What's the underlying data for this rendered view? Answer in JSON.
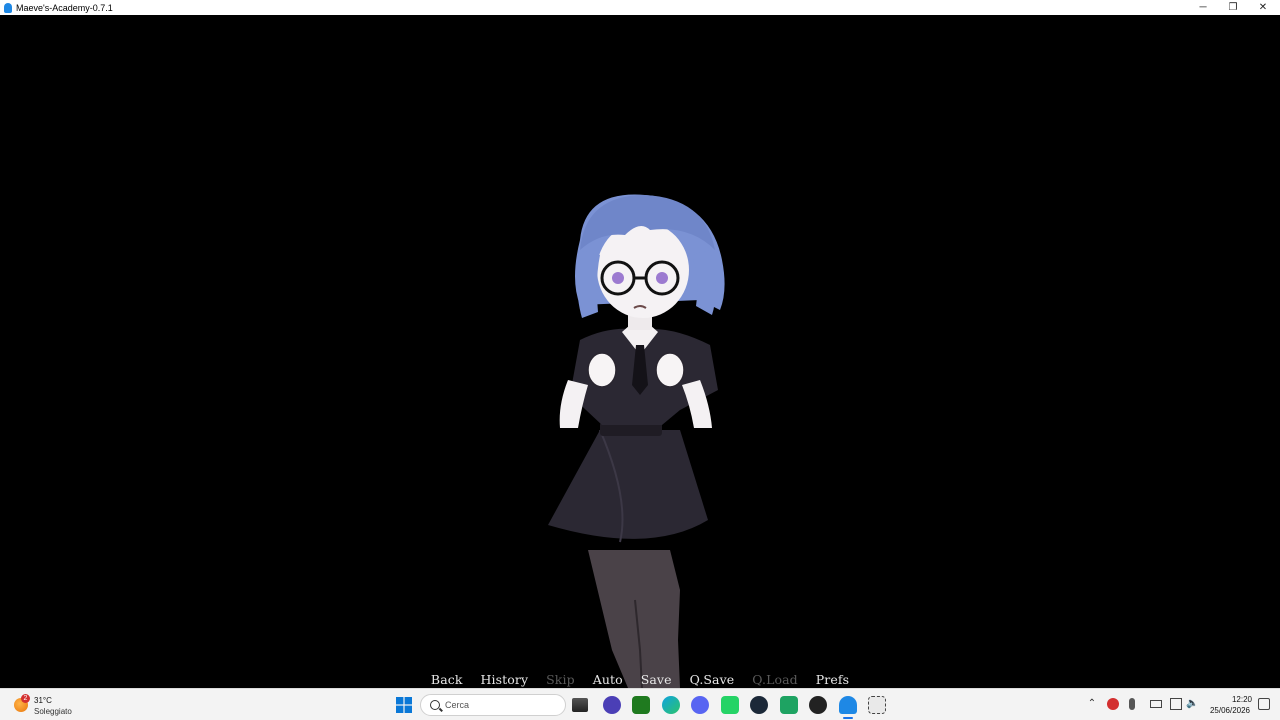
{
  "window": {
    "title": "Maeve's-Academy-0.7.1",
    "controls": [
      "─",
      "❐",
      "✕"
    ]
  },
  "quick_menu": [
    {
      "label": "Back",
      "enabled": true
    },
    {
      "label": "History",
      "enabled": true
    },
    {
      "label": "Skip",
      "enabled": false
    },
    {
      "label": "Auto",
      "enabled": true
    },
    {
      "label": "Save",
      "enabled": true
    },
    {
      "label": "Q.Save",
      "enabled": true
    },
    {
      "label": "Q.Load",
      "enabled": false
    },
    {
      "label": "Prefs",
      "enabled": true
    }
  ],
  "taskbar": {
    "weather": {
      "temp": "31°C",
      "desc": "Soleggiato",
      "badge": "2"
    },
    "search_placeholder": "Cerca",
    "pinned": [
      "file-explorer-icon",
      "protonvpn-icon",
      "xbox-icon",
      "edge-icon",
      "discord-icon",
      "whatsapp-icon",
      "steam-icon",
      "sheets-icon",
      "unity-icon",
      "maeves-academy-icon",
      "snipping-tool-icon"
    ],
    "clock": {
      "time": "12:20",
      "date": "25/06/2026"
    }
  },
  "colors": {
    "taskbar": "#f3f3f3",
    "hair": "#7b92d4",
    "dress": "#2b2833",
    "menu_text": "#e8e8e8",
    "menu_disabled": "#5a5a5a"
  }
}
